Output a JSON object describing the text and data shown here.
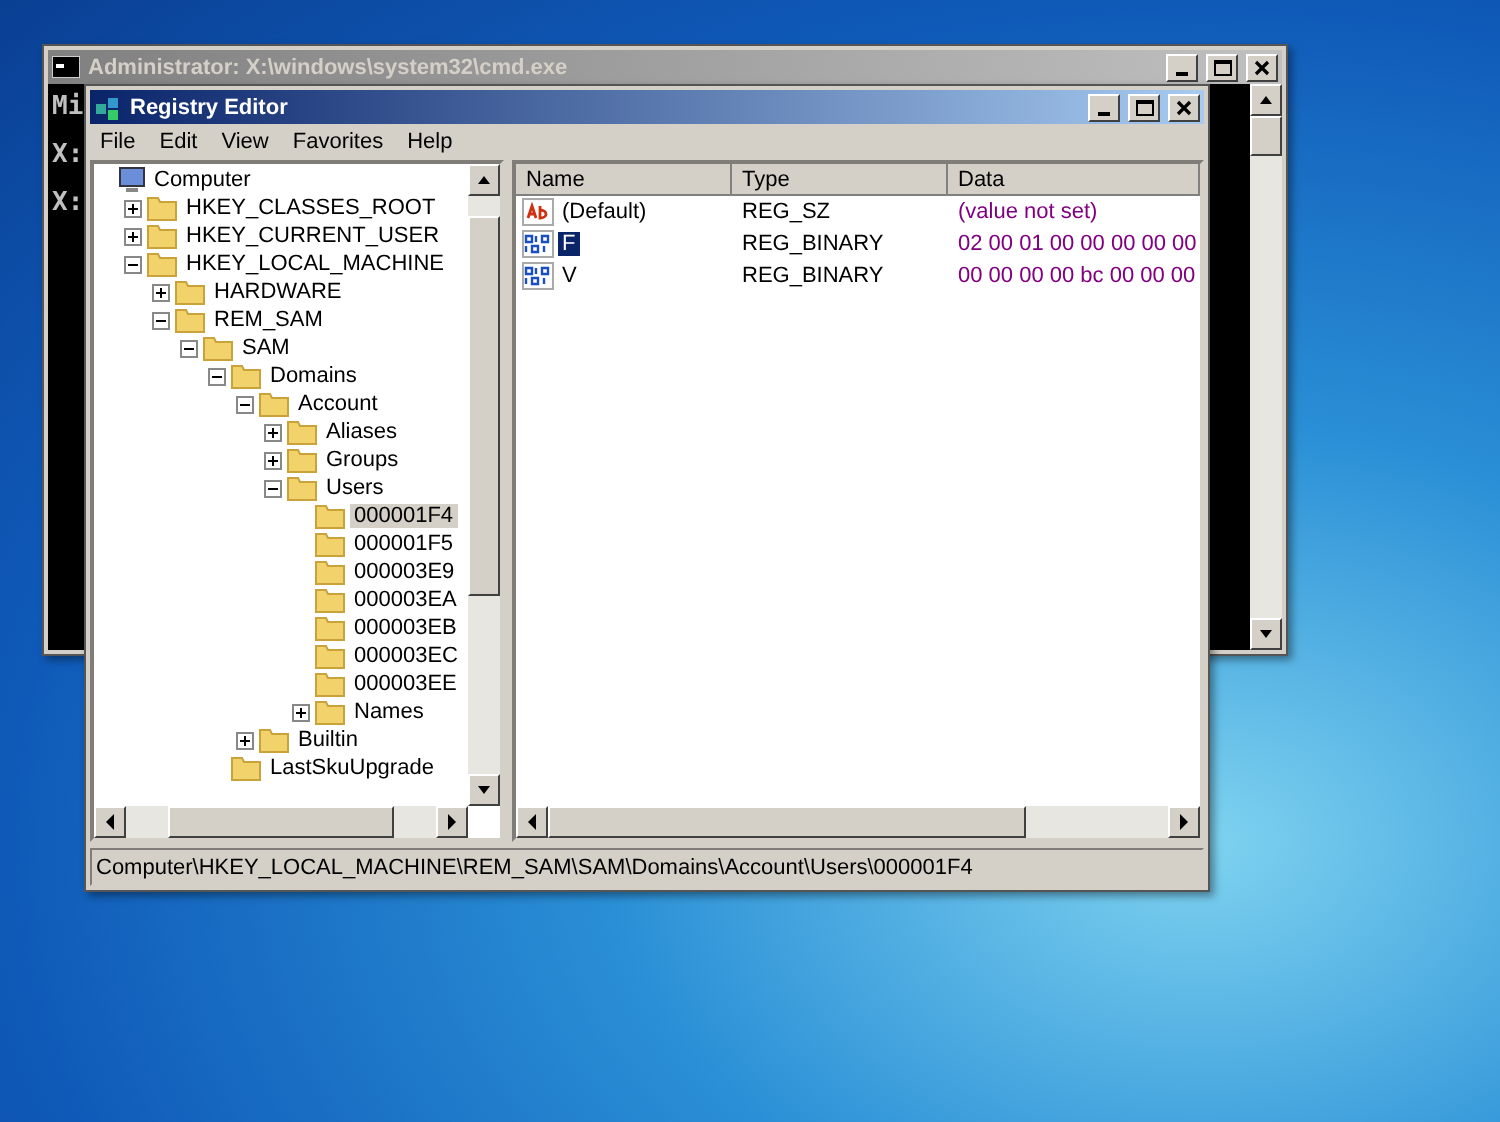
{
  "cmd_window": {
    "title": "Administrator: X:\\windows\\system32\\cmd.exe",
    "lines": [
      "Mi",
      "X:",
      "X:"
    ]
  },
  "regedit": {
    "title": "Registry Editor",
    "menu": [
      "File",
      "Edit",
      "View",
      "Favorites",
      "Help"
    ],
    "tree": [
      {
        "label": "Computer",
        "kind": "computer",
        "selected": false,
        "children": [
          {
            "label": "HKEY_CLASSES_ROOT",
            "expanded": false,
            "selected": false
          },
          {
            "label": "HKEY_CURRENT_USER",
            "expanded": false,
            "selected": false
          },
          {
            "label": "HKEY_LOCAL_MACHINE",
            "expanded": true,
            "selected": false,
            "children": [
              {
                "label": "HARDWARE",
                "expanded": false,
                "selected": false
              },
              {
                "label": "REM_SAM",
                "expanded": true,
                "selected": false,
                "children": [
                  {
                    "label": "SAM",
                    "expanded": true,
                    "selected": false,
                    "children": [
                      {
                        "label": "Domains",
                        "expanded": true,
                        "selected": false,
                        "children": [
                          {
                            "label": "Account",
                            "expanded": true,
                            "selected": false,
                            "children": [
                              {
                                "label": "Aliases",
                                "expanded": false,
                                "selected": false
                              },
                              {
                                "label": "Groups",
                                "expanded": false,
                                "selected": false
                              },
                              {
                                "label": "Users",
                                "expanded": true,
                                "selected": false,
                                "children": [
                                  {
                                    "label": "000001F4",
                                    "selected": true
                                  },
                                  {
                                    "label": "000001F5",
                                    "selected": false
                                  },
                                  {
                                    "label": "000003E9",
                                    "selected": false
                                  },
                                  {
                                    "label": "000003EA",
                                    "selected": false
                                  },
                                  {
                                    "label": "000003EB",
                                    "selected": false
                                  },
                                  {
                                    "label": "000003EC",
                                    "selected": false
                                  },
                                  {
                                    "label": "000003EE",
                                    "selected": false
                                  },
                                  {
                                    "label": "Names",
                                    "expanded": false,
                                    "selected": false
                                  }
                                ]
                              }
                            ]
                          },
                          {
                            "label": "Builtin",
                            "expanded": false,
                            "selected": false
                          }
                        ]
                      },
                      {
                        "label": "LastSkuUpgrade",
                        "selected": false
                      }
                    ]
                  }
                ]
              }
            ]
          }
        ]
      }
    ],
    "columns": [
      "Name",
      "Type",
      "Data"
    ],
    "values": [
      {
        "name": "(Default)",
        "kind": "string",
        "type": "REG_SZ",
        "data": "(value not set)",
        "selected": false
      },
      {
        "name": "F",
        "kind": "binary",
        "type": "REG_BINARY",
        "data": "02 00 01 00 00 00 00 00",
        "selected": true
      },
      {
        "name": "V",
        "kind": "binary",
        "type": "REG_BINARY",
        "data": "00 00 00 00 bc 00 00 00",
        "selected": false
      }
    ],
    "status_bar": "Computer\\HKEY_LOCAL_MACHINE\\REM_SAM\\SAM\\Domains\\Account\\Users\\000001F4"
  }
}
